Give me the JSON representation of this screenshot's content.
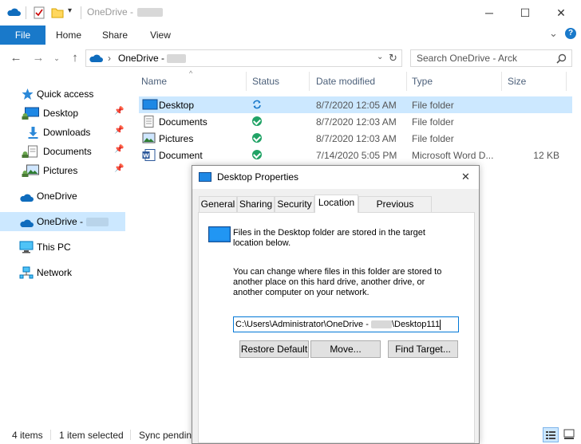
{
  "window": {
    "title": "OneDrive - ",
    "minimize": "─",
    "maximize": "☐",
    "close": "✕"
  },
  "ribbon": {
    "tabs": [
      "File",
      "Home",
      "Share",
      "View"
    ],
    "expand": "⌄",
    "help": "?"
  },
  "address": {
    "path_label": "OneDrive - ",
    "separator": "›",
    "search_placeholder": "Search OneDrive - Arck"
  },
  "nav": {
    "items": [
      {
        "label": "Quick access"
      },
      {
        "label": "Desktop"
      },
      {
        "label": "Downloads"
      },
      {
        "label": "Documents"
      },
      {
        "label": "Pictures"
      },
      {
        "label": "OneDrive"
      },
      {
        "label": "OneDrive - "
      },
      {
        "label": "This PC"
      },
      {
        "label": "Network"
      }
    ]
  },
  "list": {
    "columns": [
      "Name",
      "Status",
      "Date modified",
      "Type",
      "Size"
    ],
    "rows": [
      {
        "name": "Desktop",
        "date": "8/7/2020 12:05 AM",
        "type": "File folder",
        "size": ""
      },
      {
        "name": "Documents",
        "date": "8/7/2020 12:03 AM",
        "type": "File folder",
        "size": ""
      },
      {
        "name": "Pictures",
        "date": "8/7/2020 12:03 AM",
        "type": "File folder",
        "size": ""
      },
      {
        "name": "Document",
        "date": "7/14/2020 5:05 PM",
        "type": "Microsoft Word D...",
        "size": "12 KB"
      }
    ]
  },
  "status": {
    "items_count": "4 items",
    "selected": "1 item selected",
    "sync": "Sync pendin"
  },
  "dialog": {
    "title": "Desktop Properties",
    "close": "✕",
    "tabs": [
      "General",
      "Sharing",
      "Security",
      "Location",
      "Previous Versions"
    ],
    "text1": "Files in the Desktop folder are stored in the target location below.",
    "text2": "You can change where files in this folder are stored to another place on this hard drive, another drive, or another computer on your network.",
    "path_prefix": "C:\\Users\\Administrator\\OneDrive - ",
    "path_suffix": "\\Desktop111",
    "buttons": {
      "restore": "Restore Default",
      "move": "Move...",
      "find": "Find Target..."
    }
  },
  "colors": {
    "accent": "#1979ca",
    "selection": "#cce8ff",
    "sync_ok": "#21a366"
  }
}
